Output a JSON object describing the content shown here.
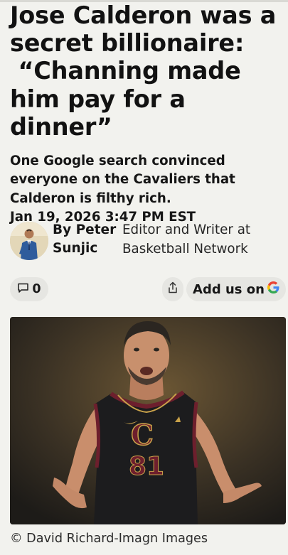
{
  "article": {
    "headline": "Jose Calderon was a secret billionaire:  “Channing made him pay for a dinner”",
    "deck": "One Google search convinced everyone on the Cavaliers that Calderon is filthy rich.",
    "date": "Jan 19, 2026 3:47 PM EST"
  },
  "author": {
    "name": "By Peter Sunjic",
    "role": "Editor and Writer at Basketball Network"
  },
  "actions": {
    "comment_count": "0",
    "google_label": "Add us on"
  },
  "photo": {
    "jersey_number": "81",
    "caption": "© David Richard-Imagn Images"
  },
  "colors": {
    "background": "#f2f2ee",
    "pill": "#e6e6e2",
    "jersey": "#1c1c1e",
    "wine": "#6d1f2d",
    "gold": "#c9a24a"
  }
}
